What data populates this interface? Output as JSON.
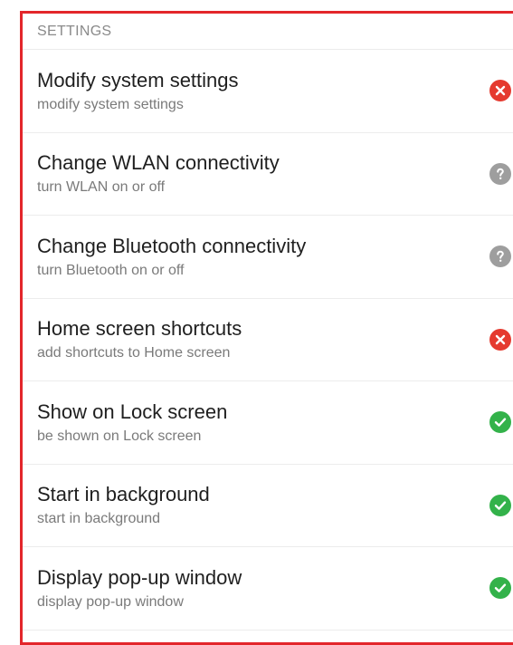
{
  "section": {
    "header": "SETTINGS"
  },
  "permissions": [
    {
      "title": "Modify system settings",
      "subtitle": "modify system settings",
      "status": "denied",
      "icon": "x-circle-icon"
    },
    {
      "title": "Change WLAN connectivity",
      "subtitle": "turn WLAN on or off",
      "status": "unknown",
      "icon": "question-circle-icon"
    },
    {
      "title": "Change Bluetooth connectivity",
      "subtitle": "turn Bluetooth on or off",
      "status": "unknown",
      "icon": "question-circle-icon"
    },
    {
      "title": "Home screen shortcuts",
      "subtitle": "add shortcuts to Home screen",
      "status": "denied",
      "icon": "x-circle-icon"
    },
    {
      "title": "Show on Lock screen",
      "subtitle": "be shown on Lock screen",
      "status": "allowed",
      "icon": "check-circle-icon"
    },
    {
      "title": "Start in background",
      "subtitle": "start in background",
      "status": "allowed",
      "icon": "check-circle-icon"
    },
    {
      "title": "Display pop-up window",
      "subtitle": "display pop-up window",
      "status": "allowed",
      "icon": "check-circle-icon"
    }
  ],
  "colors": {
    "highlight": "#e3262b",
    "denied": "#e53a2f",
    "unknown": "#9e9e9e",
    "allowed": "#33b24a"
  }
}
